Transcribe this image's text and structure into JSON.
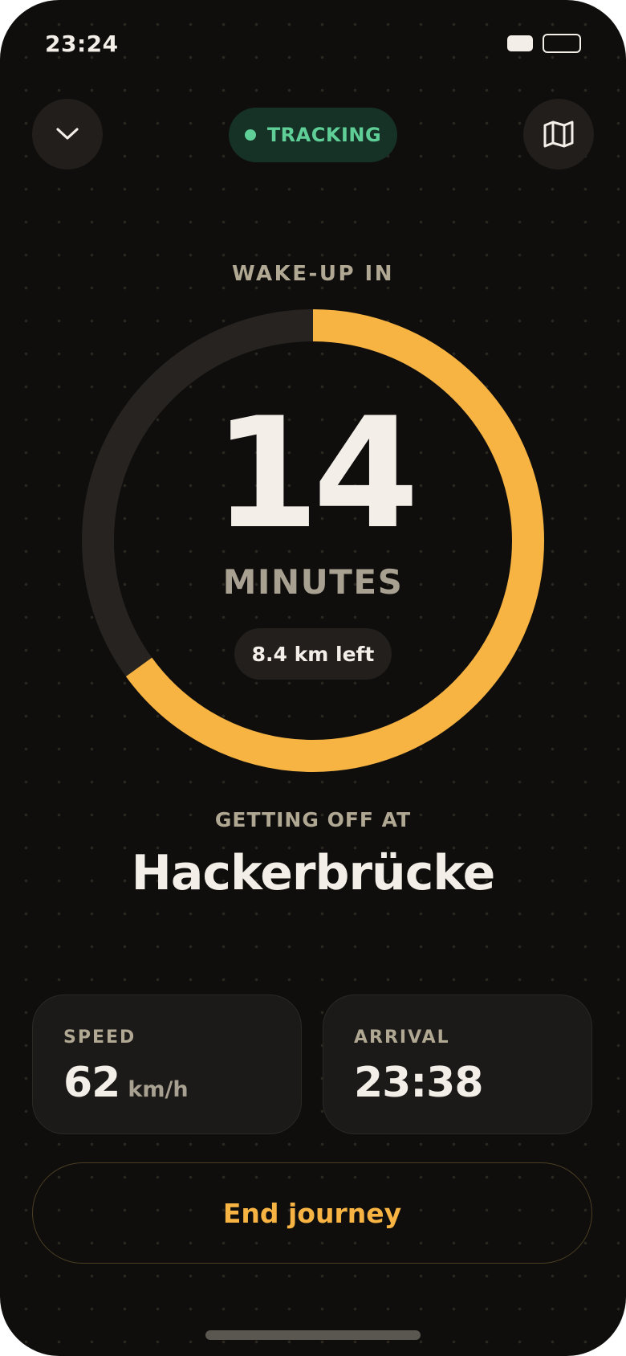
{
  "status_bar": {
    "time": "23:24"
  },
  "header": {
    "tracking_label": "TRACKING",
    "collapse_icon": "chevron-down-icon",
    "map_icon": "map-icon"
  },
  "countdown": {
    "label": "WAKE-UP IN",
    "value": "14",
    "unit": "MINUTES",
    "remaining_distance": "8.4 km left",
    "progress_fraction": 0.65
  },
  "destination": {
    "label": "GETTING OFF AT",
    "station": "Hackerbrücke"
  },
  "stats": {
    "speed": {
      "label": "SPEED",
      "value": "62",
      "unit": "km/h"
    },
    "arrival": {
      "label": "ARRIVAL",
      "value": "23:38"
    }
  },
  "actions": {
    "end_label": "End journey"
  },
  "colors": {
    "background": "#0f0e0d",
    "accent": "#f8b443",
    "tracking_green": "#5fcf97",
    "ring_track": "#262320"
  }
}
